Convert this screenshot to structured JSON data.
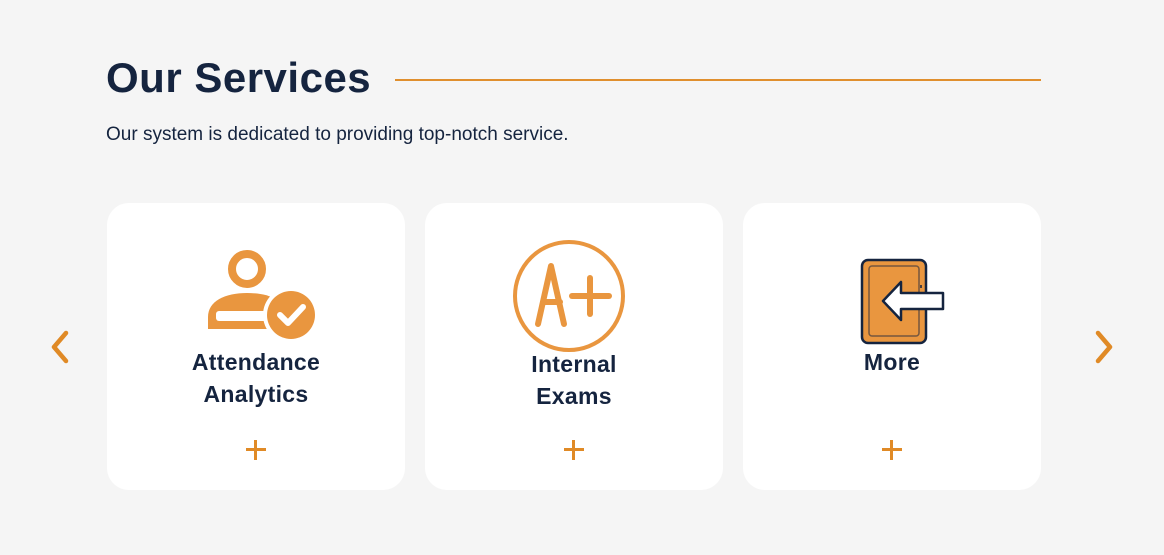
{
  "section": {
    "title": "Our Services",
    "subtitle": "Our system is dedicated to providing top-notch service."
  },
  "colors": {
    "accent": "#e08f2e",
    "icon_fill": "#e9963f",
    "heading": "#15243f",
    "background": "#f5f5f5",
    "card": "#ffffff"
  },
  "cards": [
    {
      "label": "Attendance\nAnalytics",
      "icon": "user-check-icon",
      "action": "expand-plus-icon"
    },
    {
      "label": "Internal\nExams",
      "icon": "grade-a-plus-icon",
      "action": "expand-plus-icon"
    },
    {
      "label": "More",
      "icon": "exit-door-icon",
      "action": "expand-plus-icon"
    }
  ],
  "carousel": {
    "prev_icon": "chevron-left-icon",
    "next_icon": "chevron-right-icon"
  }
}
